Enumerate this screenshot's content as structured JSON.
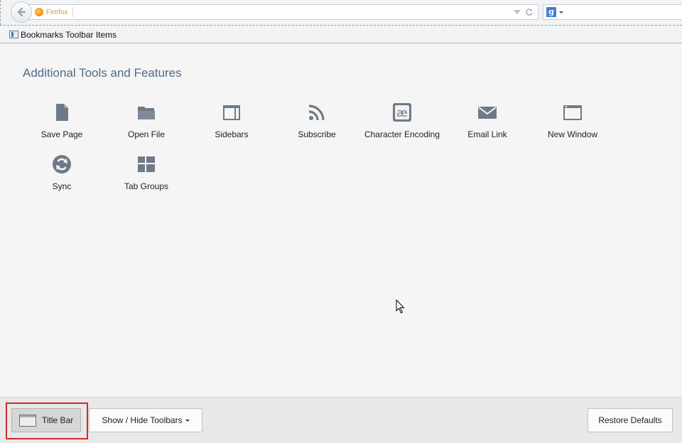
{
  "navbar": {
    "identity_label": "Firefox",
    "url_value": "",
    "search_value": ""
  },
  "bookmarks_toolbar": {
    "label": "Bookmarks Toolbar Items"
  },
  "customize": {
    "title": "Additional Tools and Features",
    "items": [
      {
        "label": "Save Page",
        "icon": "save-page-icon"
      },
      {
        "label": "Open File",
        "icon": "open-file-icon"
      },
      {
        "label": "Sidebars",
        "icon": "sidebars-icon"
      },
      {
        "label": "Subscribe",
        "icon": "subscribe-icon"
      },
      {
        "label": "Character Encoding",
        "icon": "character-encoding-icon"
      },
      {
        "label": "Email Link",
        "icon": "email-link-icon"
      },
      {
        "label": "New Window",
        "icon": "new-window-icon"
      },
      {
        "label": "Sync",
        "icon": "sync-icon"
      },
      {
        "label": "Tab Groups",
        "icon": "tab-groups-icon"
      }
    ]
  },
  "footer": {
    "title_bar_label": "Title Bar",
    "toolbars_label": "Show / Hide Toolbars",
    "restore_label": "Restore Defaults"
  },
  "colors": {
    "icon_gray": "#6e7a87",
    "title_blue": "#4f6b87",
    "highlight_red": "#d22a2a"
  }
}
